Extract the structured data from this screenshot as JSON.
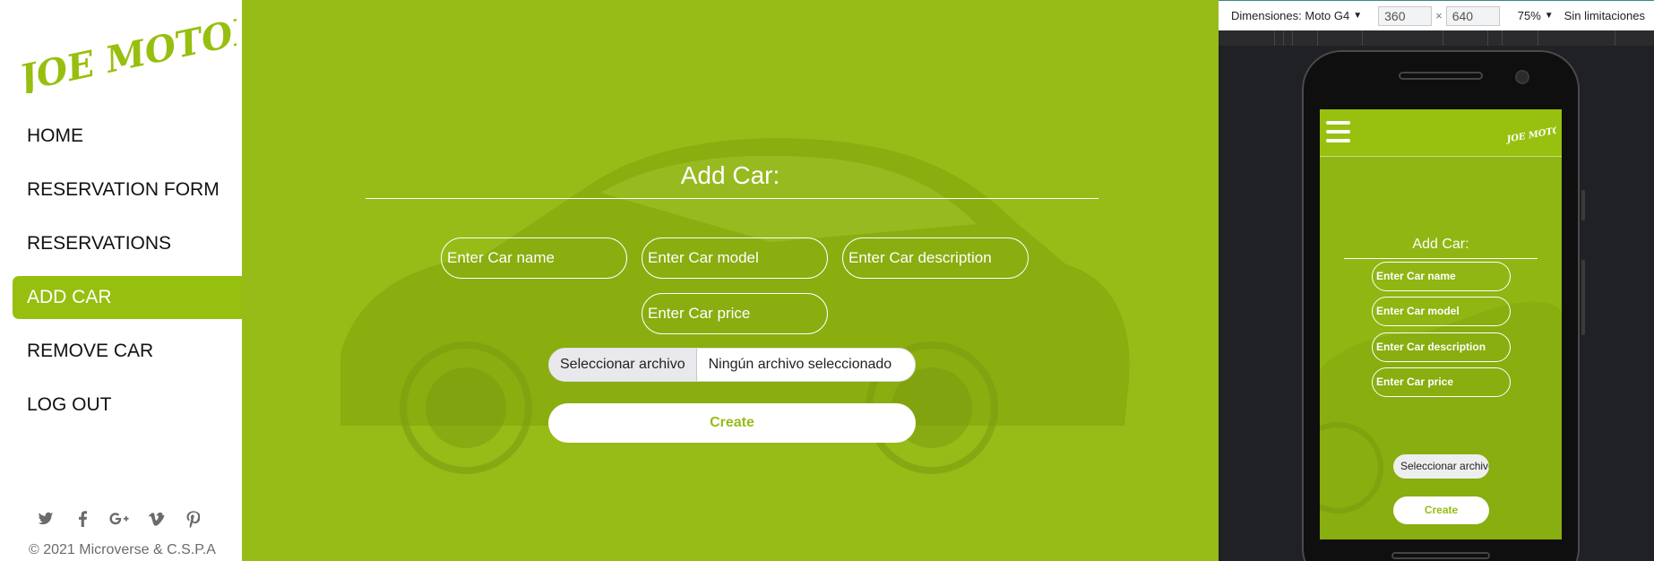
{
  "sidebar": {
    "logo_text": "JOE MOTORS",
    "items": [
      {
        "label": "HOME"
      },
      {
        "label": "RESERVATION FORM"
      },
      {
        "label": "RESERVATIONS"
      },
      {
        "label": "ADD CAR"
      },
      {
        "label": "REMOVE CAR"
      },
      {
        "label": "LOG OUT"
      }
    ],
    "active_item": "ADD CAR",
    "socials": [
      "twitter-icon",
      "facebook-icon",
      "google-plus-icon",
      "vimeo-icon",
      "pinterest-icon"
    ],
    "copyright": "© 2021 Microverse & C.S.P.A"
  },
  "form": {
    "title": "Add Car:",
    "fields": {
      "name_placeholder": "Enter Car name",
      "model_placeholder": "Enter Car model",
      "description_placeholder": "Enter Car description",
      "price_placeholder": "Enter Car price"
    },
    "file_button": "Seleccionar archivo",
    "file_status": "Ningún archivo seleccionado",
    "submit": "Create"
  },
  "devtools": {
    "dimensions_label": "Dimensiones: Moto G4",
    "width": "360",
    "times": "×",
    "height": "640",
    "zoom": "75%",
    "throttle": "Sin limitaciones"
  },
  "mobile": {
    "logo_text": "JOE MOTORS",
    "title": "Add Car:",
    "fields": [
      "Enter Car name",
      "Enter Car model",
      "Enter Car description",
      "Enter Car price"
    ],
    "file_button": "Seleccionar archivo",
    "submit": "Create"
  },
  "colors": {
    "accent": "#97bf0f",
    "main_bg": "#97bc17",
    "sidebar_text": "#111111",
    "devtools_bg": "#202124"
  }
}
